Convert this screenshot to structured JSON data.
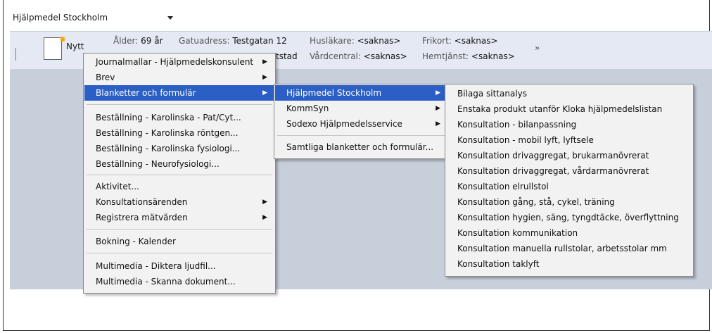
{
  "org_select": {
    "value": "Hjälpmedel Stockholm"
  },
  "toolbar": {
    "new_label": "Nytt",
    "age_label": "Ålder:",
    "age_value": "69 år",
    "street_label": "Gatuadress:",
    "street_value": "Testgatan 12",
    "city_fragment": "tstad",
    "gp_label": "Husläkare:",
    "gp_value": "<saknas>",
    "center_label": "Vårdcentral:",
    "center_value": "<saknas>",
    "frikort_label": "Frikort:",
    "frikort_value": "<saknas>",
    "home_label": "Hemtjänst:",
    "home_value": "<saknas>",
    "more_icon": "double-chevron-down-icon"
  },
  "menu1": {
    "items": [
      {
        "label": "Journalmallar - Hjälpmedelskonsulent",
        "submenu": true
      },
      {
        "label": "Brev",
        "submenu": true
      },
      {
        "label": "Blanketter och formulär",
        "submenu": true,
        "selected": true
      },
      {
        "label": "Beställning - Karolinska - Pat/Cyt..."
      },
      {
        "label": "Beställning - Karolinska röntgen..."
      },
      {
        "label": "Beställning - Karolinska fysiologi..."
      },
      {
        "label": "Beställning - Neurofysiologi..."
      },
      {
        "label": "Aktivitet..."
      },
      {
        "label": "Konsultationsärenden",
        "submenu": true
      },
      {
        "label": "Registrera mätvärden",
        "submenu": true
      },
      {
        "label": "Bokning - Kalender"
      },
      {
        "label": "Multimedia - Diktera ljudfil..."
      },
      {
        "label": "Multimedia - Skanna dokument..."
      }
    ]
  },
  "menu2": {
    "items": [
      {
        "label": "Hjälpmedel Stockholm",
        "submenu": true,
        "selected": true
      },
      {
        "label": "KommSyn",
        "submenu": true
      },
      {
        "label": "Sodexo Hjälpmedelsservice",
        "submenu": true
      },
      {
        "label": "Samtliga blanketter och formulär..."
      }
    ]
  },
  "menu3": {
    "items": [
      {
        "label": "Bilaga sittanalys"
      },
      {
        "label": "Enstaka produkt utanför Kloka hjälpmedelslistan"
      },
      {
        "label": "Konsultation - bilanpassning"
      },
      {
        "label": "Konsultation - mobil lyft, lyftsele"
      },
      {
        "label": "Konsultation drivaggregat, brukarmanövrerat"
      },
      {
        "label": "Konsultation drivaggregat, vårdarmanövrerat"
      },
      {
        "label": "Konsultation elrullstol"
      },
      {
        "label": "Konsultation gång, stå, cykel, träning"
      },
      {
        "label": "Konsultation hygien, säng, tyngdtäcke, överflyttning"
      },
      {
        "label": "Konsultation kommunikation"
      },
      {
        "label": "Konsultation manuella rullstolar, arbetsstolar mm"
      },
      {
        "label": "Konsultation taklyft"
      }
    ]
  },
  "colors": {
    "highlight": "#2b5fc5",
    "toolbar_bg": "#e4e9f3",
    "workspace_bg": "#c7cfdb",
    "menu_bg": "#f2f2f2"
  }
}
